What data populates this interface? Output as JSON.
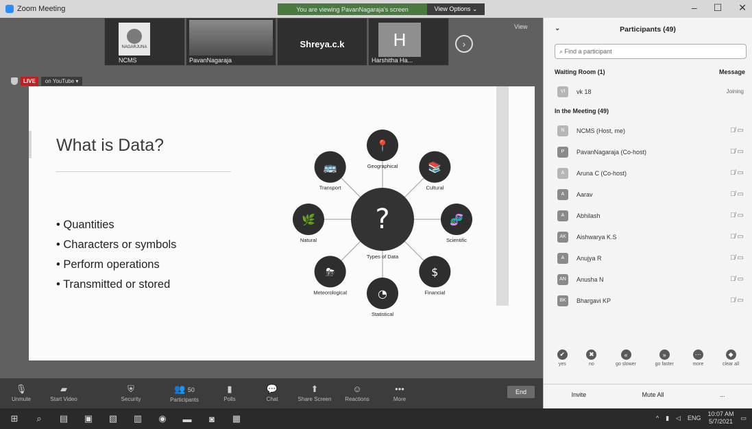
{
  "window": {
    "title": "Zoom Meeting",
    "viewing_banner": "You are viewing PavanNagaraja's screen",
    "view_options": "View Options ⌄",
    "controls": [
      "–",
      "☐",
      "✕"
    ]
  },
  "thumbnails": [
    {
      "name": "NCMS",
      "logo_text": "NAGARJUNA"
    },
    {
      "name": "PavanNagaraja"
    },
    {
      "name": "Shreya.c.k"
    },
    {
      "name": "Harshitha Ha...",
      "initial": "H"
    }
  ],
  "view_label": "View",
  "live": {
    "badge": "LIVE",
    "platform": "on YouTube ▾"
  },
  "slide": {
    "title": "What is Data?",
    "bullets": [
      "Quantities",
      "Characters or symbols",
      "Perform operations",
      "Transmitted or stored"
    ],
    "center_label": "Types of Data",
    "center_symbol": "?",
    "nodes": [
      {
        "label": "Geographical",
        "icon": "pin-icon",
        "glyph": "📍"
      },
      {
        "label": "Cultural",
        "icon": "book-icon",
        "glyph": "📚"
      },
      {
        "label": "Scientific",
        "icon": "dna-icon",
        "glyph": "🧬"
      },
      {
        "label": "Financial",
        "icon": "dollar-icon",
        "glyph": "$"
      },
      {
        "label": "Statistical",
        "icon": "piechart-icon",
        "glyph": "◔"
      },
      {
        "label": "Meteorological",
        "icon": "storm-icon",
        "glyph": "⛈"
      },
      {
        "label": "Natural",
        "icon": "leaf-icon",
        "glyph": "🌿"
      },
      {
        "label": "Transport",
        "icon": "bus-icon",
        "glyph": "🚌"
      }
    ]
  },
  "toolbar": {
    "items": [
      {
        "label": "Unmute",
        "icon": "mic-off-icon",
        "glyph": "🎙"
      },
      {
        "label": "Start Video",
        "icon": "video-off-icon",
        "glyph": "▰"
      },
      {
        "label": "Security",
        "icon": "shield-icon",
        "glyph": "⛨"
      },
      {
        "label": "Participants",
        "icon": "participants-icon",
        "glyph": "👥",
        "count": "50"
      },
      {
        "label": "Polls",
        "icon": "polls-icon",
        "glyph": "▮"
      },
      {
        "label": "Chat",
        "icon": "chat-icon",
        "glyph": "💬"
      },
      {
        "label": "Share Screen",
        "icon": "share-screen-icon",
        "glyph": "⬆"
      },
      {
        "label": "Reactions",
        "icon": "reactions-icon",
        "glyph": "☺"
      },
      {
        "label": "More",
        "icon": "more-icon",
        "glyph": "•••"
      }
    ],
    "end_label": "End"
  },
  "participants": {
    "title": "Participants (49)",
    "search_placeholder": "Find a participant",
    "waiting_room": {
      "label": "Waiting Room (1)",
      "action": "Message"
    },
    "waiting": [
      {
        "initials": "VI",
        "name": "vk 18",
        "status": "Joining"
      }
    ],
    "in_meeting_label": "In the Meeting (49)",
    "members": [
      {
        "initials": "N",
        "name": "NCMS (Host, me)"
      },
      {
        "initials": "P",
        "name": "PavanNagaraja (Co-host)"
      },
      {
        "initials": "A",
        "name": "Aruna C (Co-host)"
      },
      {
        "initials": "A",
        "name": "Aarav"
      },
      {
        "initials": "A",
        "name": "Abhilash"
      },
      {
        "initials": "AK",
        "name": "Aishwarya K.S"
      },
      {
        "initials": "A",
        "name": "Anujya R"
      },
      {
        "initials": "AN",
        "name": "Anusha N"
      },
      {
        "initials": "BK",
        "name": "Bhargavi KP"
      }
    ],
    "reactions": [
      {
        "label": "yes",
        "glyph": "✔"
      },
      {
        "label": "no",
        "glyph": "✖"
      },
      {
        "label": "go slower",
        "glyph": "«"
      },
      {
        "label": "go faster",
        "glyph": "»"
      },
      {
        "label": "more",
        "glyph": "⋯"
      },
      {
        "label": "clear all",
        "glyph": "◆"
      }
    ],
    "footer": [
      "Invite",
      "Mute All",
      "..."
    ]
  },
  "taskbar": {
    "lang": "ENG",
    "time": "10:07 AM",
    "date": "5/7/2021"
  }
}
